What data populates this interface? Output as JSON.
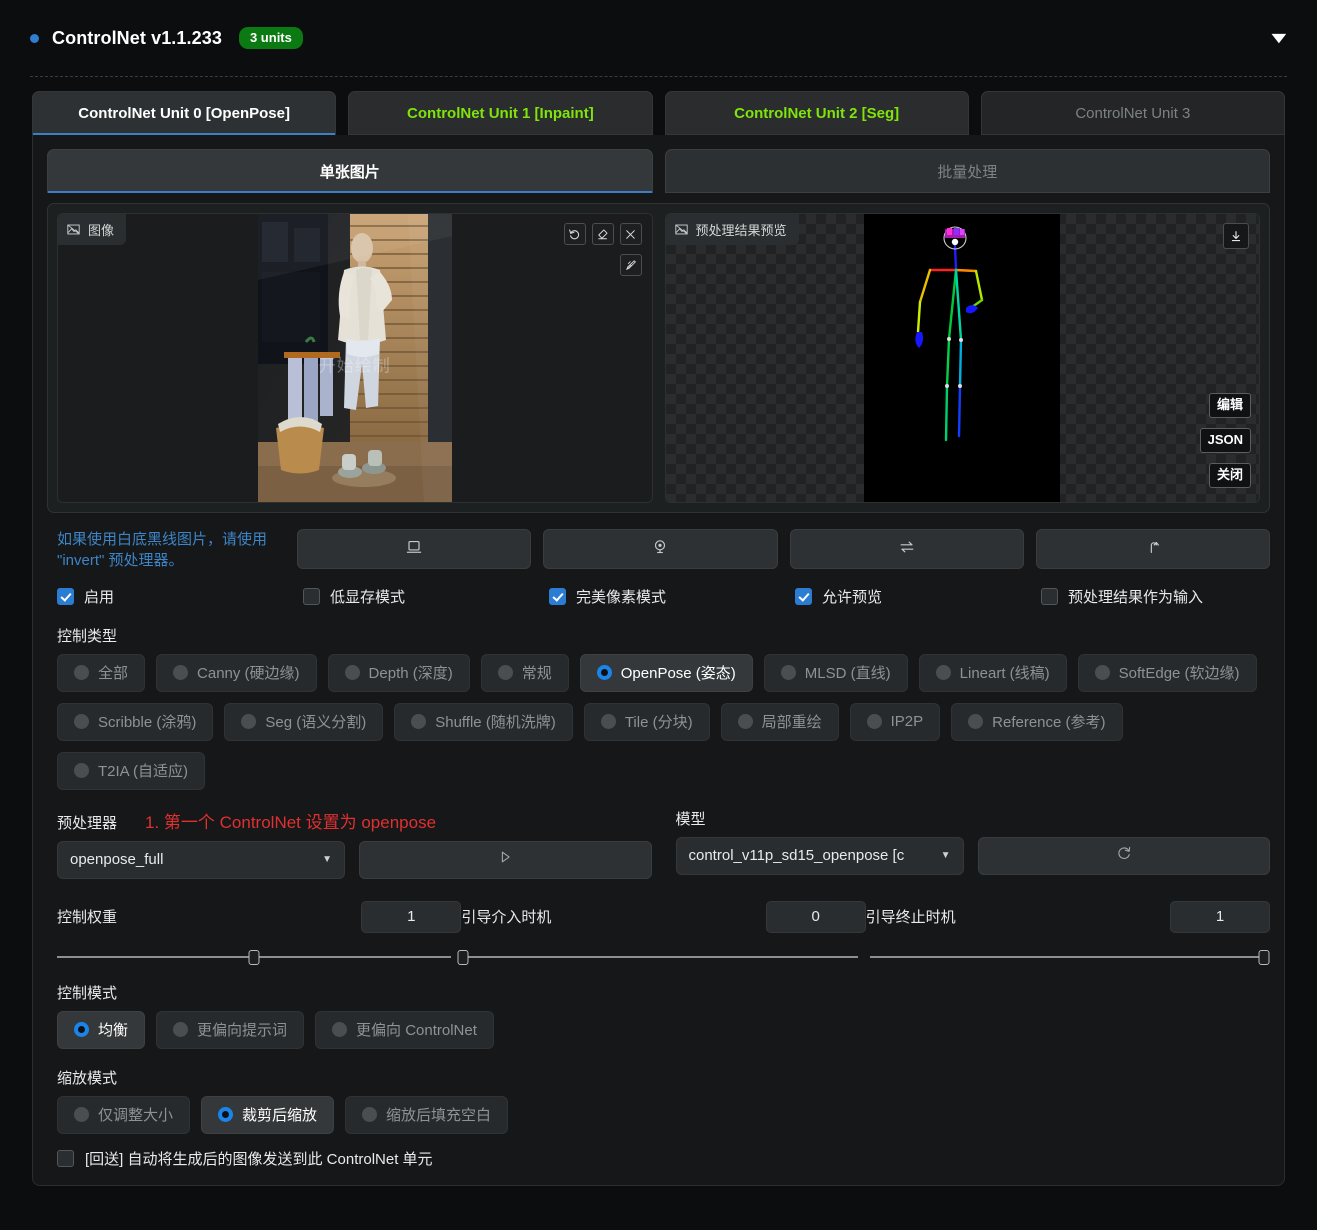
{
  "header": {
    "title": "ControlNet v1.1.233",
    "badge": "3 units",
    "collapse_icon": "triangle-down-icon",
    "accent_blue": "#2f7fd0",
    "badge_green": "#0b7a12"
  },
  "unit_tabs": [
    {
      "label": "ControlNet Unit 0 [OpenPose]",
      "state": "selected"
    },
    {
      "label": "ControlNet Unit 1 [Inpaint]",
      "state": "active"
    },
    {
      "label": "ControlNet Unit 2 [Seg]",
      "state": "active"
    },
    {
      "label": "ControlNet Unit 3",
      "state": "inactive"
    }
  ],
  "source_tabs": [
    {
      "label": "单张图片",
      "state": "selected"
    },
    {
      "label": "批量处理",
      "state": "inactive"
    }
  ],
  "image_panel": {
    "tag": "图像",
    "watermark": "开始绘制",
    "tools": [
      {
        "name": "undo-icon"
      },
      {
        "name": "eraser-icon"
      },
      {
        "name": "close-icon"
      }
    ],
    "edit_tool": "pen-edit-icon"
  },
  "preview_panel": {
    "tag": "预处理结果预览",
    "download": "download-icon",
    "side_buttons": [
      "编辑",
      "JSON",
      "关闭"
    ]
  },
  "hint": "如果使用白底黑线图片，请使用 \"invert\" 预处理器。",
  "device_buttons": [
    {
      "name": "screen-capture-icon"
    },
    {
      "name": "webcam-icon"
    },
    {
      "name": "swap-icon"
    },
    {
      "name": "upload-arrow-icon"
    }
  ],
  "checkboxes": [
    {
      "label": "启用",
      "checked": true
    },
    {
      "label": "低显存模式",
      "checked": false
    },
    {
      "label": "完美像素模式",
      "checked": true
    },
    {
      "label": "允许预览",
      "checked": true
    },
    {
      "label": "预处理结果作为输入",
      "checked": false
    }
  ],
  "control_type": {
    "label": "控制类型",
    "options": [
      {
        "label": "全部",
        "on": false
      },
      {
        "label": "Canny (硬边缘)",
        "on": false
      },
      {
        "label": "Depth (深度)",
        "on": false
      },
      {
        "label": "常规",
        "on": false
      },
      {
        "label": "OpenPose (姿态)",
        "on": true
      },
      {
        "label": "MLSD (直线)",
        "on": false
      },
      {
        "label": "Lineart (线稿)",
        "on": false
      },
      {
        "label": "SoftEdge (软边缘)",
        "on": false
      },
      {
        "label": "Scribble (涂鸦)",
        "on": false
      },
      {
        "label": "Seg (语义分割)",
        "on": false
      },
      {
        "label": "Shuffle (随机洗牌)",
        "on": false
      },
      {
        "label": "Tile (分块)",
        "on": false
      },
      {
        "label": "局部重绘",
        "on": false
      },
      {
        "label": "IP2P",
        "on": false
      },
      {
        "label": "Reference (参考)",
        "on": false
      },
      {
        "label": "T2IA (自适应)",
        "on": false
      }
    ]
  },
  "preprocessor": {
    "label": "预处理器",
    "annotation": "1. 第一个 ControlNet 设置为 openpose",
    "value": "openpose_full",
    "run_icon": "play-icon"
  },
  "model": {
    "label": "模型",
    "value": "control_v11p_sd15_openpose [c",
    "refresh_icon": "refresh-icon"
  },
  "sliders": [
    {
      "label": "控制权重",
      "value": "1",
      "pct": 50
    },
    {
      "label": "引导介入时机",
      "value": "0",
      "pct": 0
    },
    {
      "label": "引导终止时机",
      "value": "1",
      "pct": 100
    }
  ],
  "control_mode": {
    "label": "控制模式",
    "options": [
      {
        "label": "均衡",
        "on": true
      },
      {
        "label": "更偏向提示词",
        "on": false
      },
      {
        "label": "更偏向 ControlNet",
        "on": false
      }
    ]
  },
  "resize_mode": {
    "label": "缩放模式",
    "options": [
      {
        "label": "仅调整大小",
        "on": false
      },
      {
        "label": "裁剪后缩放",
        "on": true
      },
      {
        "label": "缩放后填充空白",
        "on": false
      }
    ]
  },
  "loopback": {
    "label": "[回送] 自动将生成后的图像发送到此 ControlNet 单元",
    "checked": false
  }
}
